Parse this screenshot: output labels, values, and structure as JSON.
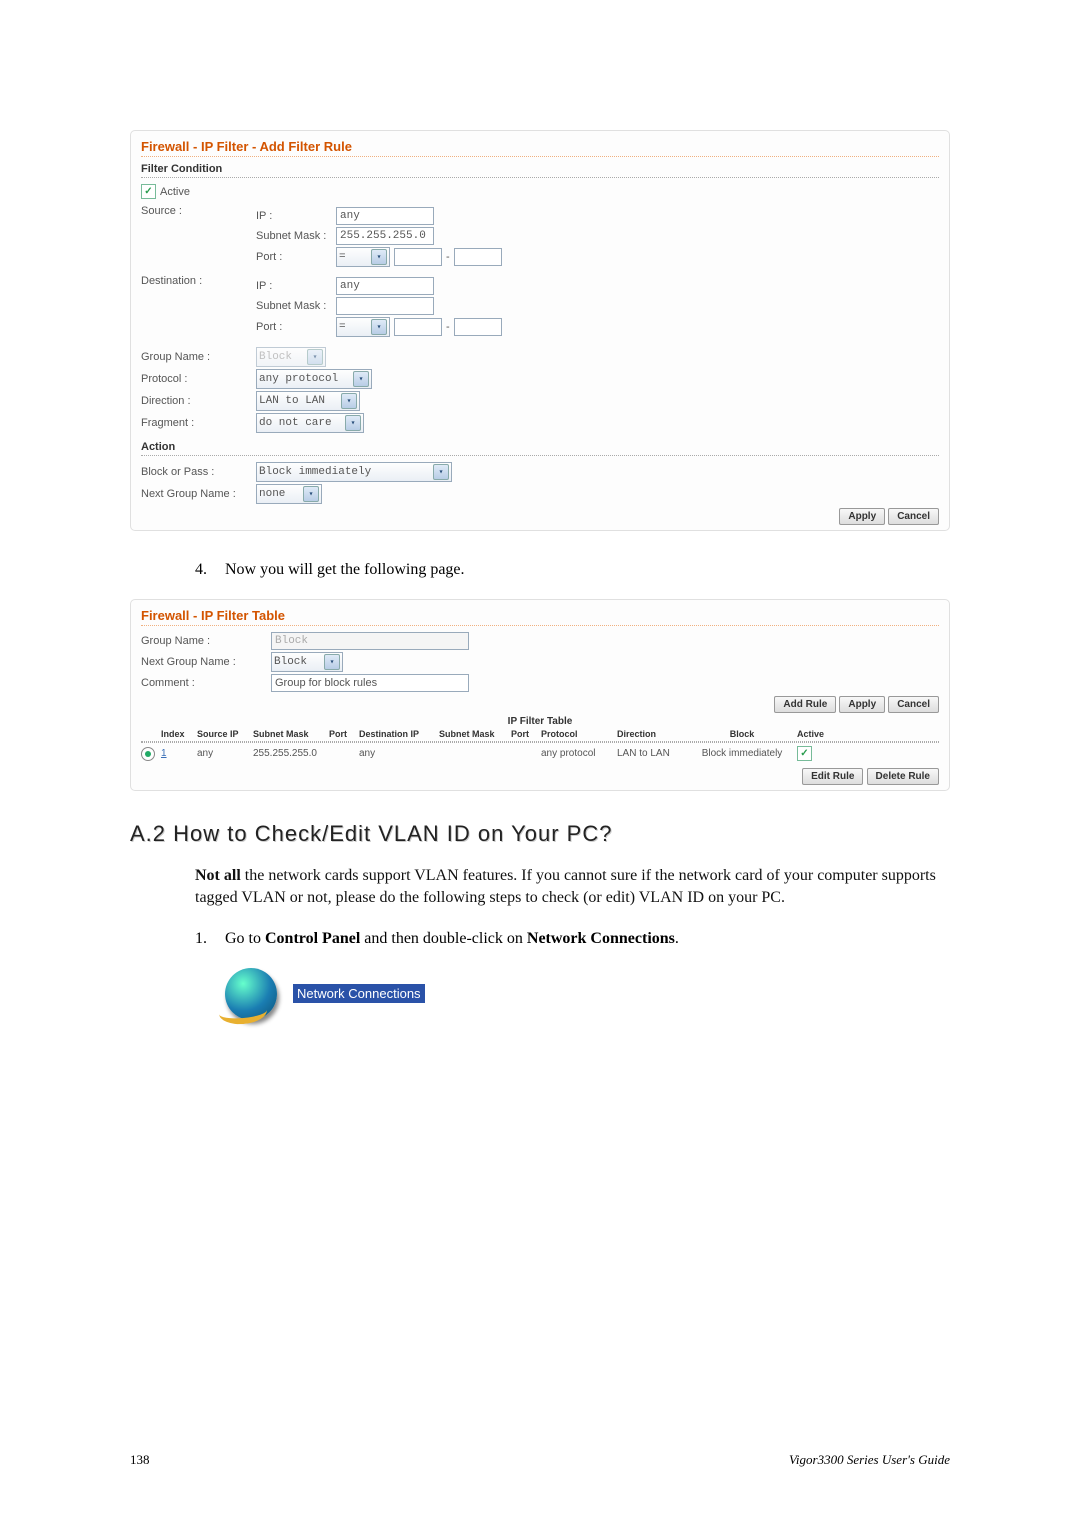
{
  "panel1": {
    "title": "Firewall - IP Filter - Add Filter Rule",
    "filter_condition": "Filter Condition",
    "active": "Active",
    "source": "Source :",
    "destination": "Destination :",
    "ip_lbl": "IP :",
    "subnet_lbl": "Subnet Mask :",
    "port_lbl": "Port :",
    "src_ip": "any",
    "src_mask": "255.255.255.0",
    "port_op": "=",
    "port_dash": "-",
    "dst_ip": "any",
    "dst_mask": "",
    "group_name_lbl": "Group Name :",
    "group_name_val": "Block",
    "protocol_lbl": "Protocol :",
    "protocol_val": "any protocol",
    "direction_lbl": "Direction :",
    "direction_val": "LAN to LAN",
    "fragment_lbl": "Fragment :",
    "fragment_val": "do not care",
    "action": "Action",
    "block_or_pass_lbl": "Block or Pass :",
    "block_or_pass_val": "Block immediately",
    "next_group_lbl": "Next Group Name :",
    "next_group_val": "none",
    "apply": "Apply",
    "cancel": "Cancel"
  },
  "step4": {
    "num": "4.",
    "text": "Now you will get the following page."
  },
  "panel2": {
    "title": "Firewall - IP Filter Table",
    "group_name_lbl": "Group Name :",
    "group_name_val": "Block",
    "next_group_lbl": "Next Group Name :",
    "next_group_val": "Block",
    "comment_lbl": "Comment :",
    "comment_val": "Group for block rules",
    "add_rule": "Add Rule",
    "apply": "Apply",
    "cancel": "Cancel",
    "table_title": "IP Filter Table",
    "headers": {
      "index": "Index",
      "src_ip": "Source IP",
      "src_mask": "Subnet Mask",
      "port1": "Port",
      "dst_ip": "Destination IP",
      "dst_mask": "Subnet Mask",
      "port2": "Port",
      "protocol": "Protocol",
      "direction": "Direction",
      "block": "Block",
      "active": "Active"
    },
    "row1": {
      "index": "1",
      "src_ip": "any",
      "src_mask": "255.255.255.0",
      "port1": "",
      "dst_ip": "any",
      "dst_mask": "",
      "port2": "",
      "protocol": "any protocol",
      "direction": "LAN to LAN",
      "block": "Block immediately"
    },
    "edit_rule": "Edit Rule",
    "delete_rule": "Delete Rule"
  },
  "section_a2": {
    "heading": "A.2 How to Check/Edit VLAN ID on Your PC?",
    "para": "Not all the network cards support VLAN features. If you cannot sure if the network card of your computer supports tagged VLAN or not, please do the following steps to check (or edit) VLAN ID on your PC.",
    "not_all": "Not all",
    "para_rest": " the network cards support VLAN features. If you cannot sure if the network card of your computer supports tagged VLAN or not, please do the following steps to check (or edit) VLAN ID on your PC."
  },
  "step1": {
    "num": "1.",
    "pre": "Go to ",
    "bold1": "Control Panel",
    "mid": " and then double-click on ",
    "bold2": "Network Connections",
    "post": "."
  },
  "nc_label": "Network Connections",
  "footer": {
    "page": "138",
    "guide": "Vigor3300 Series User's Guide"
  }
}
